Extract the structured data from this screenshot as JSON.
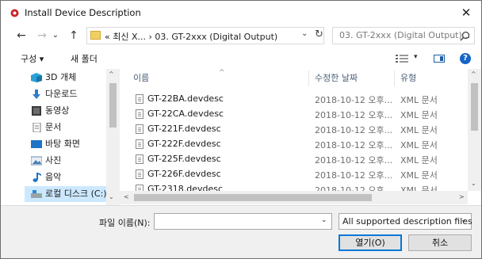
{
  "window": {
    "title": "Install Device Description",
    "close_glyph": "✕"
  },
  "nav": {
    "back": "←",
    "forward": "→",
    "dropdown": "⌄",
    "up": "↑"
  },
  "address": {
    "path": "«  최신 X...  ›  03. GT-2xxx (Digital Output)",
    "dropdown": "⌄",
    "refresh": "↻"
  },
  "search": {
    "placeholder": "03. GT-2xxx (Digital Output)..."
  },
  "toolbar": {
    "organize": "구성 ▾",
    "new_folder": "새 폴더",
    "help": "?",
    "view_dropdown": "▾"
  },
  "sidebar": {
    "items": [
      {
        "label": "3D 개체",
        "icon": "3d-objects-icon"
      },
      {
        "label": "다운로드",
        "icon": "download-icon"
      },
      {
        "label": "동영상",
        "icon": "video-icon"
      },
      {
        "label": "문서",
        "icon": "document-icon"
      },
      {
        "label": "바탕 화면",
        "icon": "desktop-icon"
      },
      {
        "label": "사진",
        "icon": "pictures-icon"
      },
      {
        "label": "음악",
        "icon": "music-icon"
      },
      {
        "label": "로컬 디스크 (C:)",
        "icon": "drive-icon"
      }
    ]
  },
  "columns": {
    "name": "이름",
    "date": "수정한 날짜",
    "type": "유형",
    "sort_caret": "^"
  },
  "files": [
    {
      "name": "GT-22BA.devdesc",
      "date": "2018-10-12 오후...",
      "type": "XML 문서"
    },
    {
      "name": "GT-22CA.devdesc",
      "date": "2018-10-12 오후...",
      "type": "XML 문서"
    },
    {
      "name": "GT-221F.devdesc",
      "date": "2018-10-12 오후...",
      "type": "XML 문서"
    },
    {
      "name": "GT-222F.devdesc",
      "date": "2018-10-12 오후...",
      "type": "XML 문서"
    },
    {
      "name": "GT-225F.devdesc",
      "date": "2018-10-12 오후...",
      "type": "XML 문서"
    },
    {
      "name": "GT-226F.devdesc",
      "date": "2018-10-12 오후...",
      "type": "XML 문서"
    },
    {
      "name": "GT-2318.devdesc",
      "date": "2018-10-12 오후...",
      "type": "XML 문서"
    }
  ],
  "scroll": {
    "up": "^",
    "down": "⌄",
    "left": "<",
    "right": ">"
  },
  "footer": {
    "filename_label": "파일 이름(N):",
    "filename_value": "",
    "dropdown": "⌄",
    "filter": "All supported description files",
    "open": "열기(O)",
    "cancel": "취소"
  },
  "colors": {
    "accent": "#0078d7",
    "selection": "#cce8ff",
    "help": "#1465c7"
  }
}
